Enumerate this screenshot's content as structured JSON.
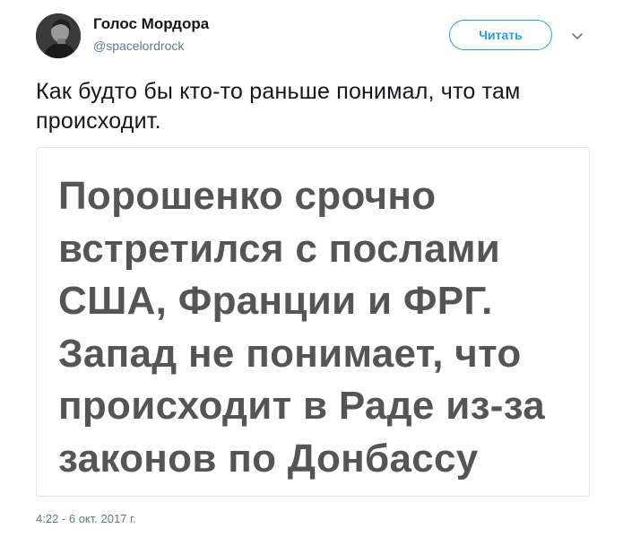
{
  "author": {
    "display_name": "Голос Мордора",
    "handle": "@spacelordrock",
    "avatar_icon": "user-avatar"
  },
  "follow_button": {
    "label": "Читать",
    "color": "#1da1f2"
  },
  "menu": {
    "icon": "chevron-down-icon"
  },
  "tweet": {
    "text": "Как будто бы кто-то раньше понимал, что там происходит."
  },
  "media": {
    "headline_lines": [
      "Порошенко срочно",
      "встретился с послами",
      "США, Франции и ФРГ.",
      "Запад не понимает, что",
      "происходит в Раде из-за",
      "законов по Донбассу"
    ]
  },
  "meta": {
    "timestamp": "4:22 - 6 окт. 2017 г."
  }
}
